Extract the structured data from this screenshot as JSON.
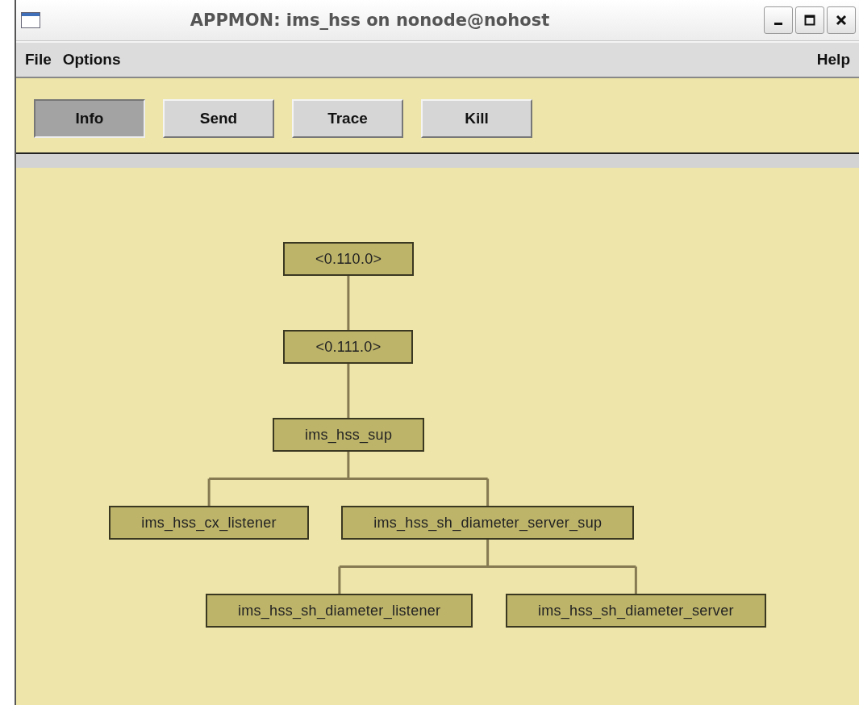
{
  "window": {
    "title": "APPMON: ims_hss on nonode@nohost"
  },
  "menu_left": [
    "File",
    "Options"
  ],
  "menu_right": [
    "Help"
  ],
  "buttons": [
    {
      "label": "Info",
      "selected": true
    },
    {
      "label": "Send",
      "selected": false
    },
    {
      "label": "Trace",
      "selected": false
    },
    {
      "label": "Kill",
      "selected": false
    }
  ],
  "tree": {
    "label": "<0.110.0>",
    "children": [
      {
        "label": "<0.111.0>",
        "children": [
          {
            "label": "ims_hss_sup",
            "children": [
              {
                "label": "ims_hss_cx_listener"
              },
              {
                "label": "ims_hss_sh_diameter_server_sup",
                "children": [
                  {
                    "label": "ims_hss_sh_diameter_listener"
                  },
                  {
                    "label": "ims_hss_sh_diameter_server"
                  }
                ]
              }
            ]
          }
        ]
      }
    ]
  }
}
